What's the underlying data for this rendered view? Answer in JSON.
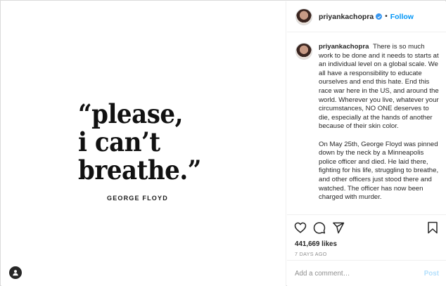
{
  "image": {
    "quote_lines": [
      "“please,",
      "i can’t",
      "breathe.”"
    ],
    "author": "GEORGE FLOYD",
    "user_tag_icon": "person-icon"
  },
  "header": {
    "username": "priyankachopra",
    "separator": "•",
    "follow_label": "Follow",
    "verified_icon": "verified-badge-icon"
  },
  "caption": {
    "username": "priyankachopra",
    "paragraphs": [
      "There is so much work to be done and it needs to starts at an individual level on a global scale. We all have a responsibility to educate ourselves and end this hate. End this race war here in the US, and around the world. Wherever you live, whatever your circumstances, NO ONE deserves to die, especially at the hands of another because of their skin color.",
      "On May 25th, George Floyd was pinned down by the neck by a Minneapolis police officer and died. He laid there, fighting for his life, struggling to breathe, and other officers just stood there and watched. The officer has now been charged with murder."
    ]
  },
  "actions": {
    "like_icon": "heart-icon",
    "comment_icon": "comment-icon",
    "share_icon": "share-icon",
    "save_icon": "bookmark-icon"
  },
  "likes": "441,669 likes",
  "timestamp": "7 DAYS AGO",
  "comment_box": {
    "placeholder": "Add a comment…",
    "post_label": "Post"
  },
  "colors": {
    "link_blue": "#0095f6",
    "verified_blue": "#3897f0",
    "post_disabled": "#b2dffc",
    "muted": "#8e8e8e"
  }
}
